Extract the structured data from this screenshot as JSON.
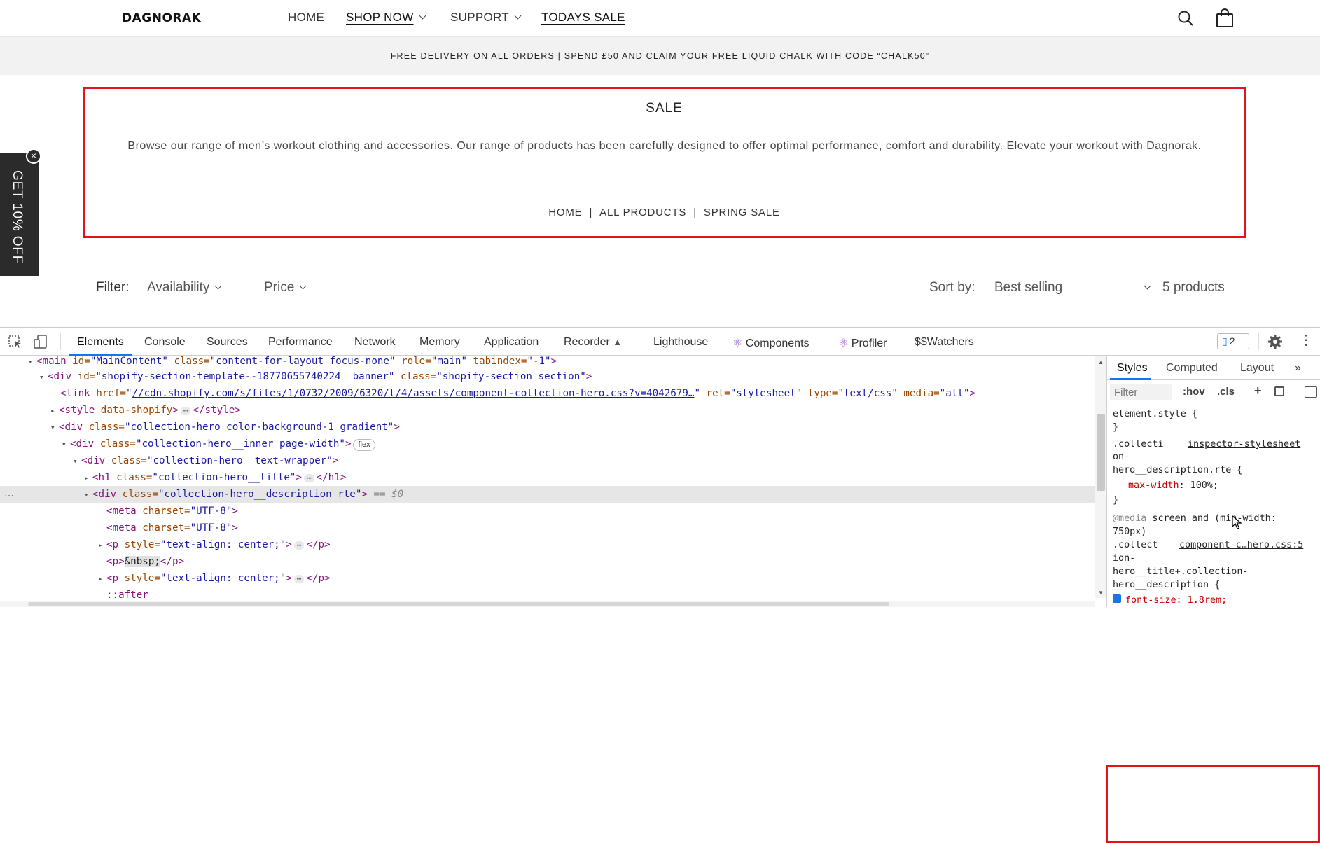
{
  "store": {
    "logo": "DAGNORAK",
    "nav": [
      {
        "label": "HOME"
      },
      {
        "label": "SHOP NOW"
      },
      {
        "label": "SUPPORT"
      },
      {
        "label": "TODAYS SALE"
      }
    ],
    "announcement": "FREE DELIVERY ON ALL ORDERS | SPEND £50 AND CLAIM YOUR FREE LIQUID CHALK WITH CODE “CHALK50”"
  },
  "hero": {
    "title": "SALE",
    "description": "Browse our range of men’s workout clothing and accessories. Our range of products has been carefully designed to offer optimal performance, comfort and durability. Elevate your workout with Dagnorak.",
    "breadcrumbs": [
      "HOME",
      "ALL PRODUCTS",
      "SPRING SALE"
    ],
    "separator": "|"
  },
  "promo": {
    "label": "GET 10% OFF",
    "close": "×"
  },
  "filters": {
    "filter_label": "Filter:",
    "availability": "Availability",
    "price": "Price",
    "sort_label": "Sort by:",
    "sort_value": "Best selling",
    "count": "5 products"
  },
  "devtools": {
    "tabs": [
      "Elements",
      "Console",
      "Sources",
      "Performance",
      "Network",
      "Memory",
      "Application",
      "Recorder",
      "Lighthouse",
      "Components",
      "Profiler",
      "$$Watchers"
    ],
    "issues_count": "2",
    "dom": {
      "l0_tag": "<main ",
      "l0_attr1": "id=",
      "l0_val1": "\"MainContent\"",
      "l0_attr2": " class=",
      "l0_val2": "\"content-for-layout focus-none\"",
      "l0_attr3": " role=",
      "l0_val3": "\"main\"",
      "l0_attr4": " tabindex=",
      "l0_val4": "\"-1\"",
      "l0_end": ">",
      "l1_tag": "<div ",
      "l1_attr1": "id=",
      "l1_val1": "\"shopify-section-template--18770655740224__banner\"",
      "l1_attr2": " class=",
      "l1_val2": "\"shopify-section section\"",
      "l1_end": ">",
      "l2_tag": "<link ",
      "l2_attr1": "href=",
      "l2_q1": "\"",
      "l2_href": "//cdn.shopify.com/s/files/1/0732/2009/6320/t/4/assets/component-collection-hero.css?v=4042679…",
      "l2_q2": "\"",
      "l2_attr2": " rel=",
      "l2_val2": "\"stylesheet\"",
      "l2_attr3": " type=",
      "l2_val3": "\"text/css\"",
      "l2_attr4": " media=",
      "l2_val4": "\"all\"",
      "l2_end": ">",
      "l3_tag": "<style ",
      "l3_attr1": "data-shopify",
      "l3_end": ">",
      "l3_close": "</style>",
      "l4_tag": "<div ",
      "l4_attr1": "class=",
      "l4_val1": "\"collection-hero color-background-1 gradient\"",
      "l4_end": ">",
      "l5_tag": "<div ",
      "l5_attr1": "class=",
      "l5_val1": "\"collection-hero__inner page-width\"",
      "l5_end": ">",
      "l5_pill": "flex",
      "l6_tag": "<div ",
      "l6_attr1": "class=",
      "l6_val1": "\"collection-hero__text-wrapper\"",
      "l6_end": ">",
      "l7_tag": "<h1 ",
      "l7_attr1": "class=",
      "l7_val1": "\"collection-hero__title\"",
      "l7_end": ">",
      "l7_close": "</h1>",
      "l8_tag": "<div ",
      "l8_attr1": "class=",
      "l8_val1": "\"collection-hero__description rte\"",
      "l8_end": ">",
      "l8_eq": " == $0",
      "l9_tag": "<meta ",
      "l9_attr1": "charset=",
      "l9_val1": "\"UTF-8\"",
      "l9_end": ">",
      "l10_tag": "<meta ",
      "l10_attr1": "charset=",
      "l10_val1": "\"UTF-8\"",
      "l10_end": ">",
      "l11_tag": "<p ",
      "l11_attr1": "style=",
      "l11_val1": "\"text-align: center;\"",
      "l11_end": ">",
      "l11_close": "</p>",
      "l12_open": "<p>",
      "l12_text": "&nbsp;",
      "l12_close": "</p>",
      "l13_tag": "<p ",
      "l13_attr1": "style=",
      "l13_val1": "\"text-align: center;\"",
      "l13_end": ">",
      "l13_close": "</p>",
      "l14_pseudo": "::after"
    },
    "styles": {
      "tabs": [
        "Styles",
        "Computed",
        "Layout",
        "»"
      ],
      "filter_placeholder": "Filter",
      "hov": ":hov",
      "cls": ".cls",
      "plus": "+",
      "element_style": "element.style {",
      "close_brace": "}",
      "rule1_sel_a": ".collecti",
      "rule1_sel_b": "on-",
      "rule1_sel_c": "hero__description.rte {",
      "rule1_source": "inspector-stylesheet",
      "rule1_prop": "max-width",
      "rule1_val": ": 100%;",
      "media_kw": "@media",
      "media_text": " screen and (min-width:",
      "media_text2": "750px)",
      "rule2_sel_a": ".collect",
      "rule2_sel_b": "ion-",
      "rule2_sel_c": "hero__title+.collection-",
      "rule2_sel_d": "hero__description {",
      "rule2_source": "component-c…hero.css:5",
      "rule2_prop": "font-size: 1.8rem;"
    }
  },
  "colors": {
    "highlight_border": "#e8111b",
    "devtools_accent": "#1a73e8",
    "promo_bg": "#2b2b2b"
  }
}
